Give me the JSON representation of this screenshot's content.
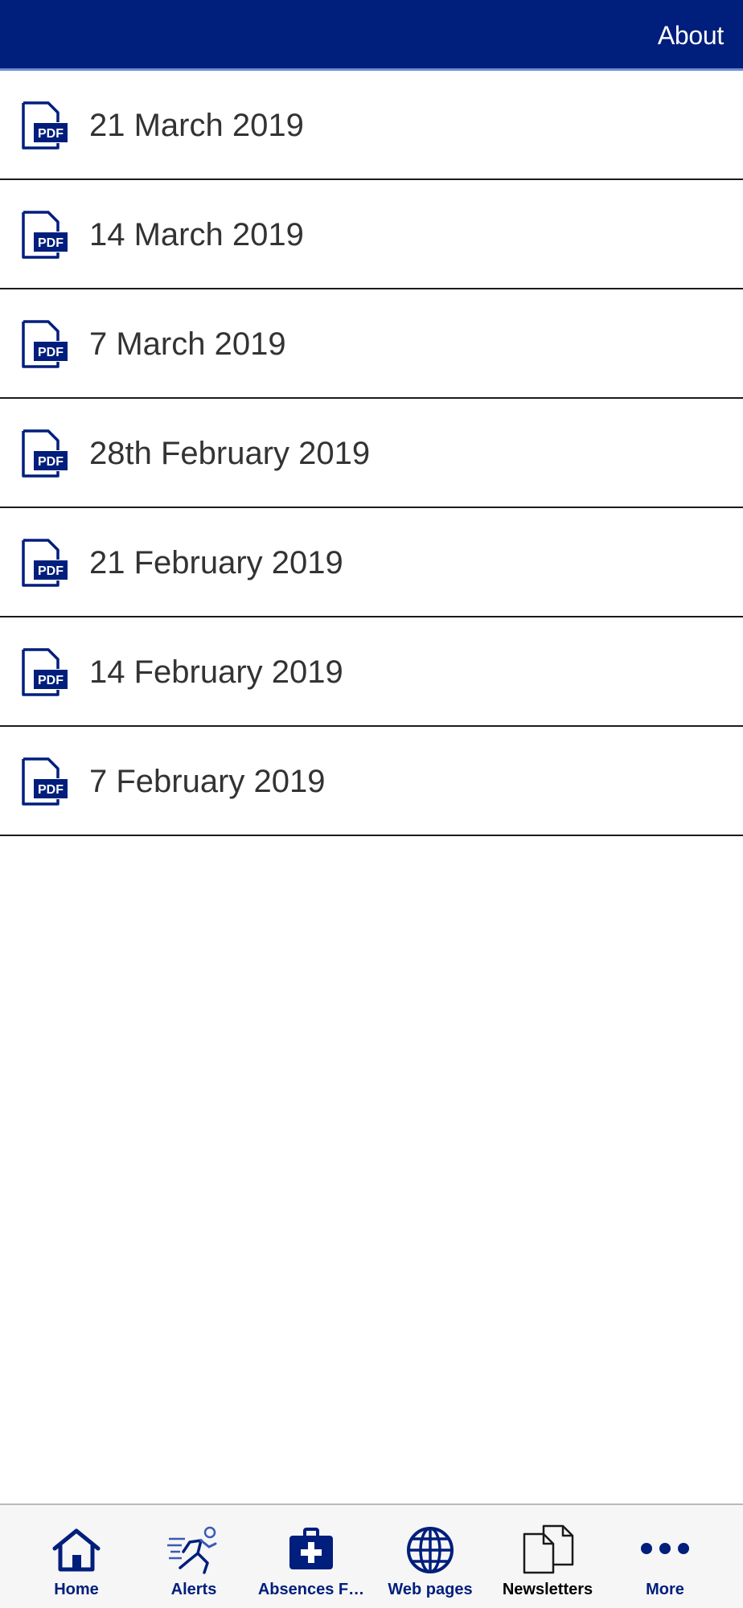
{
  "header": {
    "about_label": "About"
  },
  "newsletters": [
    {
      "label": "21 March 2019",
      "icon": "pdf-icon"
    },
    {
      "label": "14 March 2019",
      "icon": "pdf-icon"
    },
    {
      "label": "7 March 2019",
      "icon": "pdf-icon"
    },
    {
      "label": "28th February 2019",
      "icon": "pdf-icon"
    },
    {
      "label": "21 February 2019",
      "icon": "pdf-icon"
    },
    {
      "label": "14 February 2019",
      "icon": "pdf-icon"
    },
    {
      "label": "7 February 2019",
      "icon": "pdf-icon"
    }
  ],
  "tabbar": {
    "tabs": [
      {
        "label": "Home",
        "icon": "home-icon",
        "active": false
      },
      {
        "label": "Alerts",
        "icon": "runner-icon",
        "active": false
      },
      {
        "label": "Absences F…",
        "icon": "first-aid-kit-icon",
        "active": false
      },
      {
        "label": "Web pages",
        "icon": "globe-icon",
        "active": false
      },
      {
        "label": "Newsletters",
        "icon": "documents-icon",
        "active": true
      },
      {
        "label": "More",
        "icon": "more-dots-icon",
        "active": false
      }
    ]
  },
  "colors": {
    "brand_navy": "#001e7c",
    "header_underline": "#6a8fd6",
    "row_text": "#333333",
    "divider": "#1b1b1b",
    "tabbar_bg": "#f6f6f6"
  }
}
